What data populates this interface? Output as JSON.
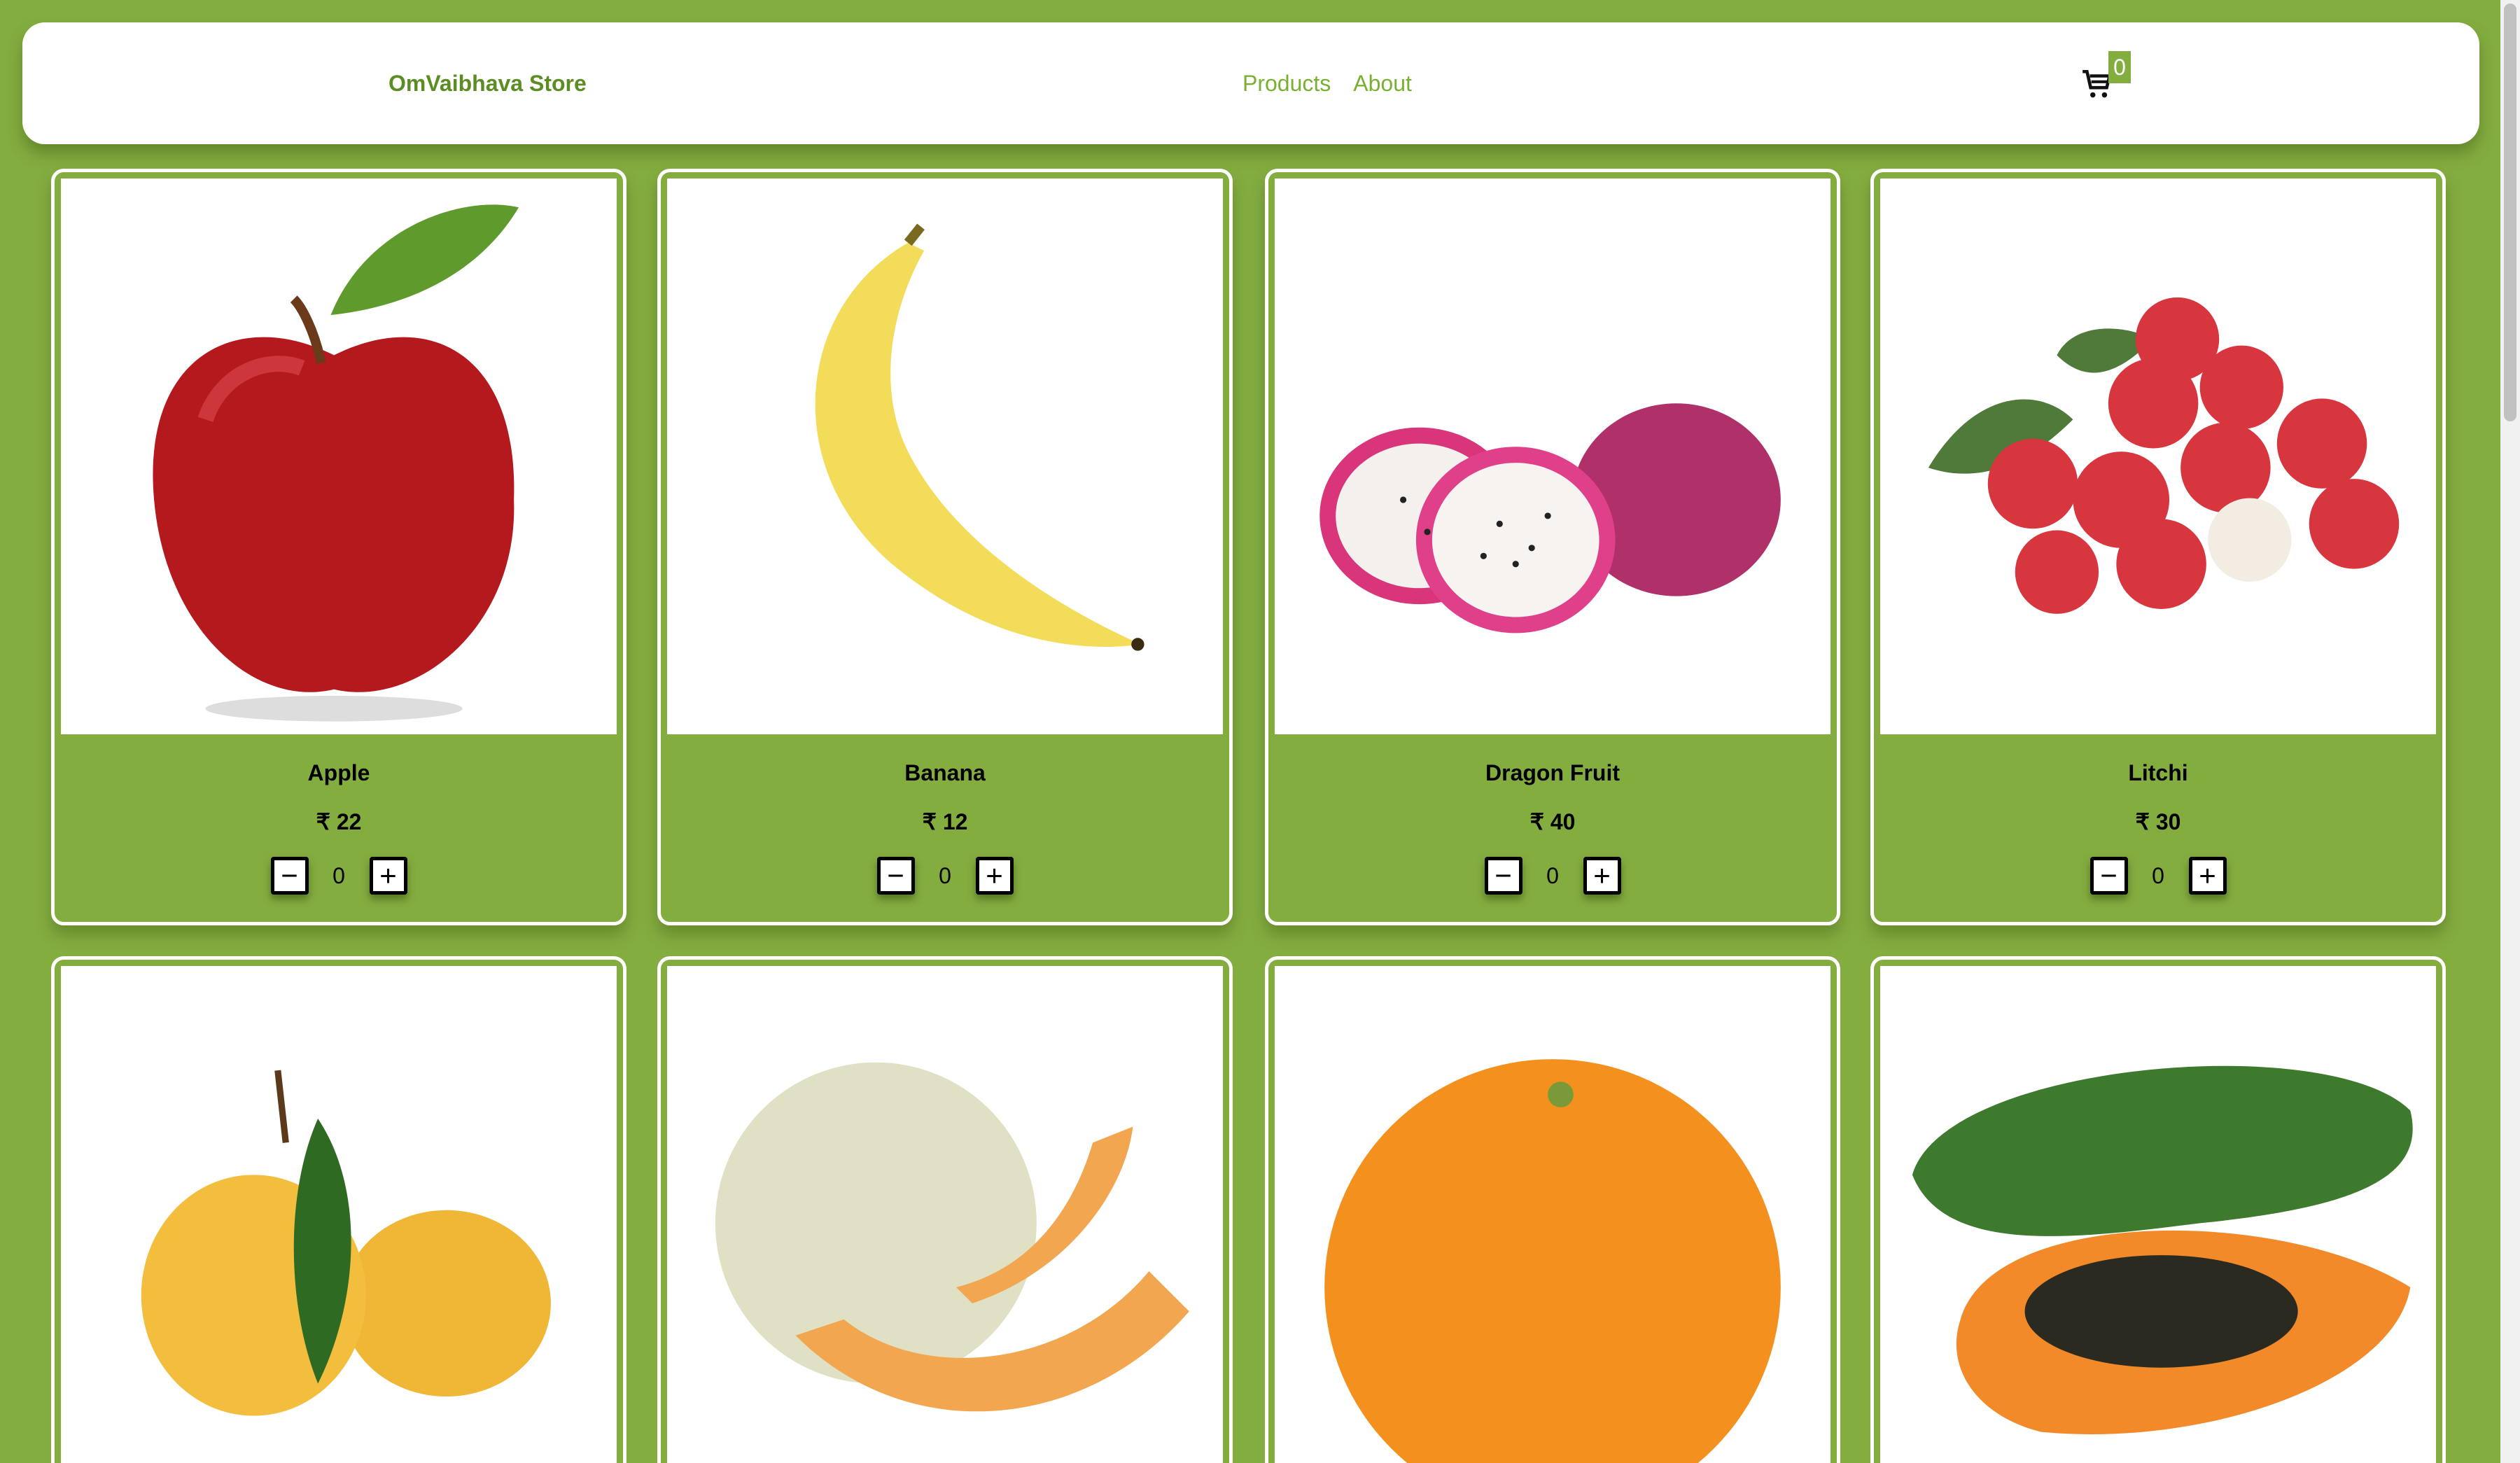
{
  "header": {
    "brand": "OmVaibhava Store",
    "nav": [
      {
        "label": "Products"
      },
      {
        "label": "About"
      }
    ],
    "cart_icon": "shopping-cart-icon",
    "cart_count": "0"
  },
  "colors": {
    "background": "#84ad40",
    "brand": "#5b8d23",
    "nav": "#7ab032"
  },
  "products": [
    {
      "name": "Apple",
      "price": "₹ 22",
      "qty": "0",
      "image": "apple"
    },
    {
      "name": "Banana",
      "price": "₹ 12",
      "qty": "0",
      "image": "banana"
    },
    {
      "name": "Dragon Fruit",
      "price": "₹ 40",
      "qty": "0",
      "image": "dragon-fruit"
    },
    {
      "name": "Litchi",
      "price": "₹ 30",
      "qty": "0",
      "image": "litchi"
    },
    {
      "image": "mango"
    },
    {
      "image": "melon"
    },
    {
      "image": "orange"
    },
    {
      "image": "papaya"
    }
  ],
  "stepper": {
    "minus": "−",
    "plus": "+"
  }
}
